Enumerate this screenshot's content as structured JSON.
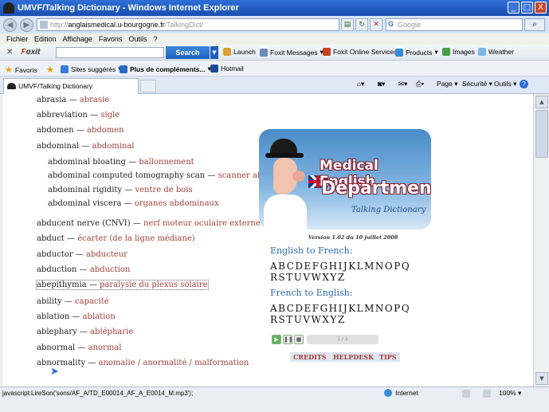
{
  "window": {
    "title": "UMVF/Talking Dictionary - Windows Internet Explorer",
    "minimize": "_",
    "maximize": "□",
    "close": "X"
  },
  "address": {
    "url_prefix": "http://",
    "url_host": "anglaismedical.u-bourgogne.fr",
    "url_path": "/TalkingDict/",
    "search_placeholder": "Google",
    "search_go": "⌕"
  },
  "menu": {
    "items": [
      "Fichier",
      "Edition",
      "Affichage",
      "Favoris",
      "Outils",
      "?"
    ]
  },
  "foxit_toolbar": {
    "close": "✕",
    "logo": "Foxit",
    "search_label": "Search",
    "launch": "Launch",
    "messages": "Foxit Messages",
    "online_services": "Foxit Online Services",
    "products": "Products",
    "images": "Images",
    "weather": "Weather"
  },
  "favorites_bar": {
    "favoris": "Favoris",
    "sites": "Sites suggérés",
    "plus": "Plus de compléments...",
    "hotmail": "Hotmail"
  },
  "tabs": {
    "active": "UMVF/Talking Dictionary",
    "page": "Page",
    "securite": "Sécurité",
    "outils": "Outils",
    "help": "?"
  },
  "dictionary": {
    "entries": [
      {
        "en": "abrasia",
        "fr": "abrasie"
      },
      {
        "en": "abbreviation",
        "fr": "sigle"
      },
      {
        "en": "abdomen",
        "fr": "abdomen"
      },
      {
        "en": "abdominal",
        "fr": "abdominal"
      },
      {
        "en": "abdominal bloating",
        "fr": "ballonnement"
      },
      {
        "en": "abdominal computed tomography scan",
        "fr": "scanner abdominal"
      },
      {
        "en": "abdominal rigidity",
        "fr": "ventre de bois"
      },
      {
        "en": "abdominal viscera",
        "fr": "organes abdominaux"
      },
      {
        "en": "abducent nerve (CNVI)",
        "fr": "nerf moteur oculaire externe"
      },
      {
        "en": "abduct",
        "fr": "écarter (de la ligne médiane)"
      },
      {
        "en": "abductor",
        "fr": "abducteur"
      },
      {
        "en": "abduction",
        "fr": "abduction"
      },
      {
        "en": "abepithymia",
        "fr": "paralysie du plexus solaire"
      },
      {
        "en": "ability",
        "fr": "capacité"
      },
      {
        "en": "ablation",
        "fr": "ablation"
      },
      {
        "en": "ablephary",
        "fr": "ablépharie"
      },
      {
        "en": "abnormal",
        "fr": "anormal"
      },
      {
        "en": "abnormality",
        "fr": "anomalie / anormalité / malformation"
      }
    ]
  },
  "banner": {
    "line1": "Medical English",
    "line2": "Department",
    "subtitle": "Talking Dictionary"
  },
  "version": "Version 1.02 du 10 juillet 2008",
  "en_to_fr": {
    "title": "English to French:",
    "row1": "ABCDEFGHIJKLMNOPQ",
    "row2": "RSTUVWXYZ"
  },
  "fr_to_en": {
    "title": "French to English:",
    "row1": "ABCDEFGHIJKLMNOPQ",
    "row2": "RSTUVWXYZ"
  },
  "player": {
    "play": "▶",
    "pause": "❚❚",
    "stop": "■",
    "track": "1 / 1"
  },
  "links": {
    "credits": "CREDITS",
    "helpdesk": "HELPDESK",
    "tips": "TIPS"
  },
  "status": {
    "text": "javascript:LireSon('sons/AF_A/TD_E00014_AF_A_E0014_M.mp3');",
    "zone": "Internet",
    "zoom": "100%"
  }
}
